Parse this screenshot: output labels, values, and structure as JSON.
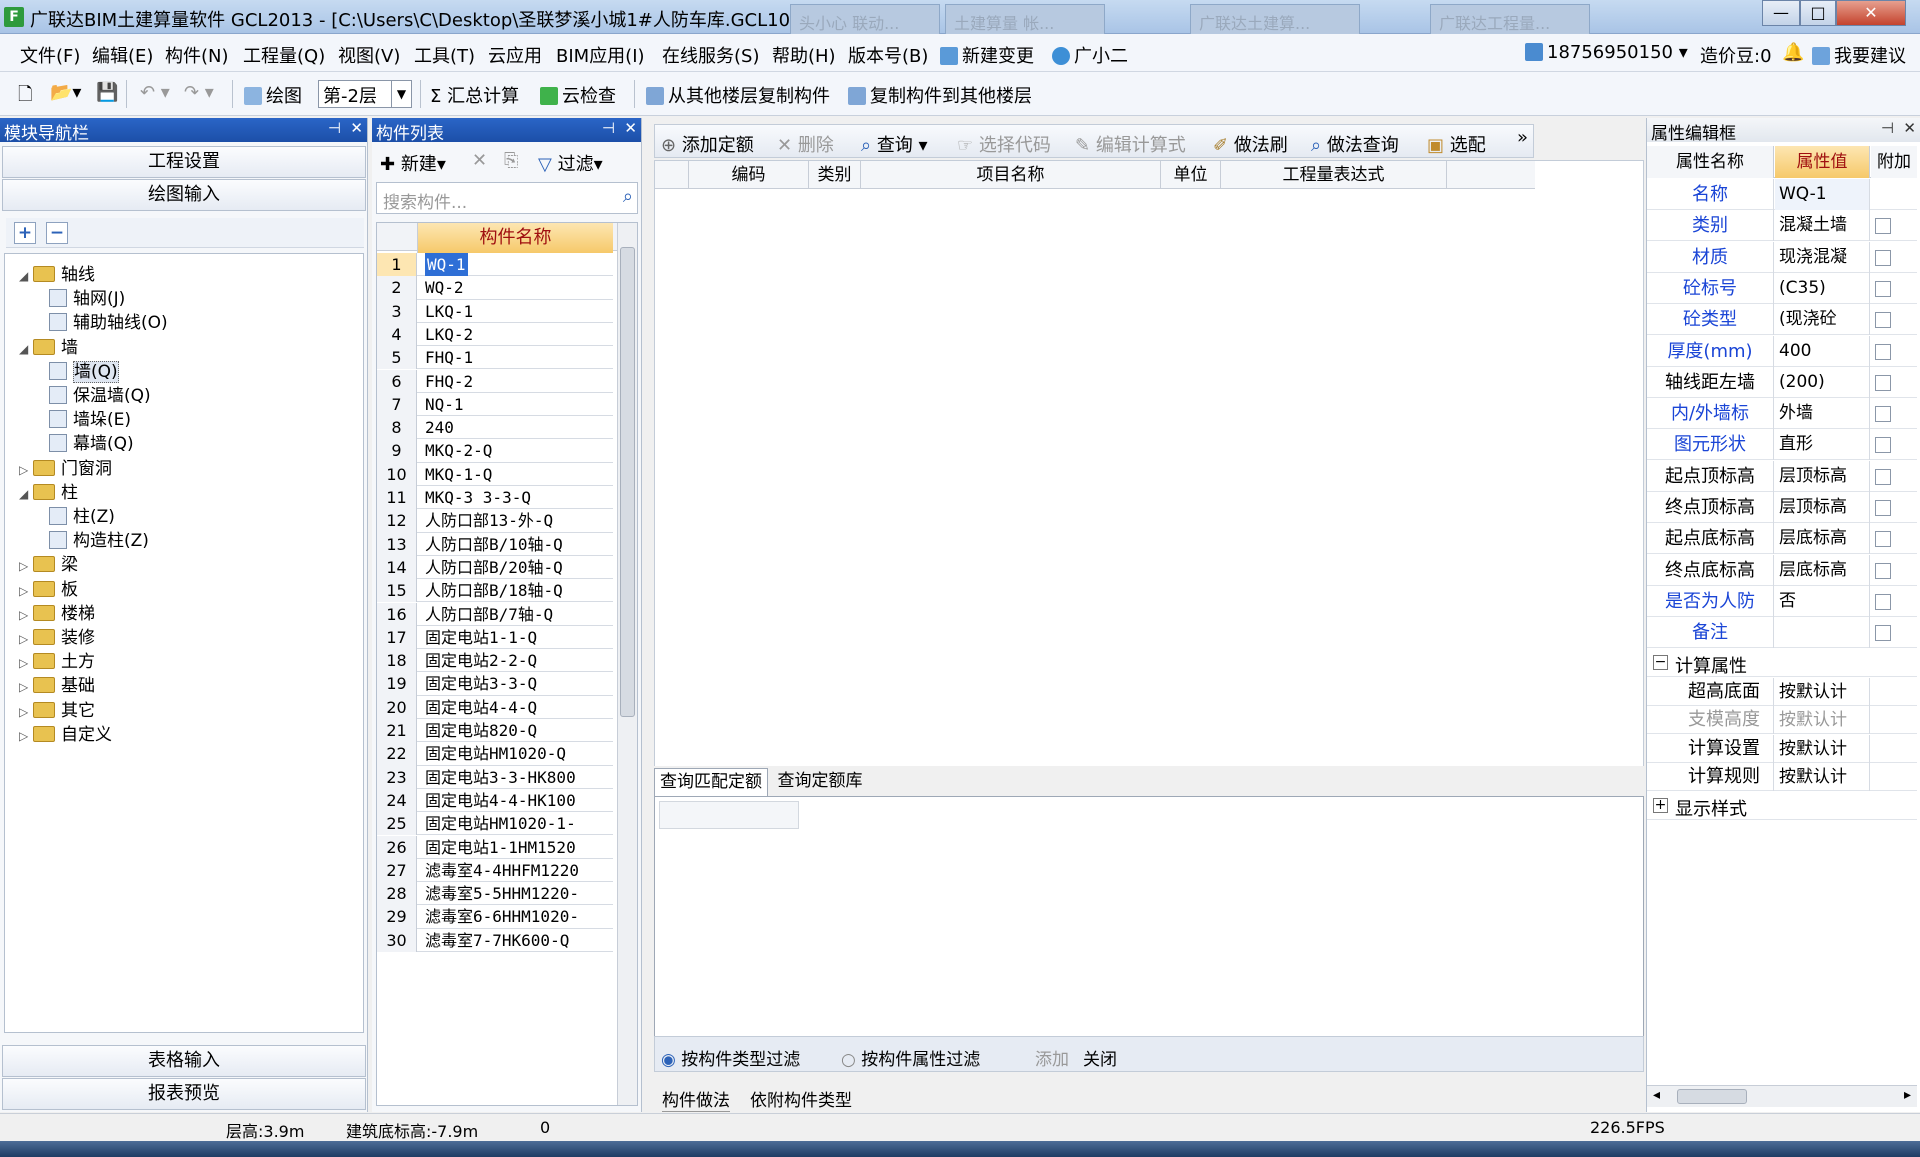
{
  "window": {
    "title": "广联达BIM土建算量软件 GCL2013 - [C:\\Users\\C\\Desktop\\圣联梦溪小城1#人防车库.GCL10]",
    "app_icon": "F",
    "bg_tabs": [
      "头小心 联动...",
      "土建算量  帐...",
      "广联达土建算...",
      "广联达工程量..."
    ],
    "controls": [
      "—",
      "□",
      "✕"
    ]
  },
  "menu": [
    "文件(F)",
    "编辑(E)",
    "构件(N)",
    "工程量(Q)",
    "视图(V)",
    "工具(T)",
    "云应用",
    "BIM应用(I)",
    "在线服务(S)",
    "帮助(H)",
    "版本号(B)",
    "新建变更",
    "广小二"
  ],
  "account": {
    "phone": "18756950150",
    "beans": "造价豆:0",
    "suggest": "我要建议"
  },
  "toolbar": {
    "draw": "绘图",
    "floor": "第-2层",
    "sum": "汇总计算",
    "cloud_check": "云检查",
    "copy_from": "从其他楼层复制构件",
    "copy_to": "复制构件到其他楼层"
  },
  "nav_panel": {
    "title": "模块导航栏",
    "top_buttons": [
      "工程设置",
      "绘图输入"
    ],
    "bottom_buttons": [
      "表格输入",
      "报表预览"
    ],
    "tree": [
      {
        "label": "轴线",
        "level": 0,
        "expanded": true,
        "type": "folder"
      },
      {
        "label": "轴网(J)",
        "level": 1,
        "type": "leaf"
      },
      {
        "label": "辅助轴线(O)",
        "level": 1,
        "type": "leaf"
      },
      {
        "label": "墙",
        "level": 0,
        "expanded": true,
        "type": "folder"
      },
      {
        "label": "墙(Q)",
        "level": 1,
        "type": "leaf",
        "selected": true
      },
      {
        "label": "保温墙(Q)",
        "level": 1,
        "type": "leaf"
      },
      {
        "label": "墙垛(E)",
        "level": 1,
        "type": "leaf"
      },
      {
        "label": "幕墙(Q)",
        "level": 1,
        "type": "leaf"
      },
      {
        "label": "门窗洞",
        "level": 0,
        "expanded": false,
        "type": "folder"
      },
      {
        "label": "柱",
        "level": 0,
        "expanded": true,
        "type": "folder"
      },
      {
        "label": "柱(Z)",
        "level": 1,
        "type": "leaf"
      },
      {
        "label": "构造柱(Z)",
        "level": 1,
        "type": "leaf"
      },
      {
        "label": "梁",
        "level": 0,
        "expanded": false,
        "type": "folder"
      },
      {
        "label": "板",
        "level": 0,
        "expanded": false,
        "type": "folder"
      },
      {
        "label": "楼梯",
        "level": 0,
        "expanded": false,
        "type": "folder"
      },
      {
        "label": "装修",
        "level": 0,
        "expanded": false,
        "type": "folder"
      },
      {
        "label": "土方",
        "level": 0,
        "expanded": false,
        "type": "folder"
      },
      {
        "label": "基础",
        "level": 0,
        "expanded": false,
        "type": "folder"
      },
      {
        "label": "其它",
        "level": 0,
        "expanded": false,
        "type": "folder"
      },
      {
        "label": "自定义",
        "level": 0,
        "expanded": false,
        "type": "folder"
      }
    ]
  },
  "component_panel": {
    "title": "构件列表",
    "new": "新建",
    "filter": "过滤",
    "search_placeholder": "搜索构件...",
    "column": "构件名称",
    "rows": [
      "WQ-1",
      "WQ-2",
      "LKQ-1",
      "LKQ-2",
      "FHQ-1",
      "FHQ-2",
      "NQ-1",
      "240",
      "MKQ-2-Q",
      "MKQ-1-Q",
      "MKQ-3 3-3-Q",
      "人防口部13-外-Q",
      "人防口部B/10轴-Q",
      "人防口部B/20轴-Q",
      "人防口部B/18轴-Q",
      "人防口部B/7轴-Q",
      "固定电站1-1-Q",
      "固定电站2-2-Q",
      "固定电站3-3-Q",
      "固定电站4-4-Q",
      "固定电站820-Q",
      "固定电站HM1020-Q",
      "固定电站3-3-HK800",
      "固定电站4-4-HK100",
      "固定电站HM1020-1-",
      "固定电站1-1HM1520",
      "滤毒室4-4HHFM1220",
      "滤毒室5-5HHM1220-",
      "滤毒室6-6HHM1020-",
      "滤毒室7-7HK600-Q"
    ]
  },
  "quota_panel": {
    "toolbar": [
      "添加定额",
      "删除",
      "查询",
      "选择代码",
      "编辑计算式",
      "做法刷",
      "做法查询",
      "选配"
    ],
    "more": "»",
    "columns": [
      "编码",
      "类别",
      "项目名称",
      "单位",
      "工程量表达式"
    ],
    "lower_tabs": [
      "查询匹配定额",
      "查询定额库"
    ],
    "filter_type": "按构件类型过滤",
    "filter_attr": "按构件属性过滤",
    "add": "添加",
    "close": "关闭",
    "bottom_tabs": [
      "构件做法",
      "依附构件类型"
    ]
  },
  "property_panel": {
    "title": "属性编辑框",
    "headers": [
      "属性名称",
      "属性值",
      "附加"
    ],
    "rows": [
      {
        "name": "名称",
        "value": "WQ-1",
        "blue": true,
        "check": false
      },
      {
        "name": "类别",
        "value": "混凝土墙",
        "blue": true,
        "check": true
      },
      {
        "name": "材质",
        "value": "现浇混凝",
        "blue": true,
        "check": true
      },
      {
        "name": "砼标号",
        "value": "(C35)",
        "blue": true,
        "check": true
      },
      {
        "name": "砼类型",
        "value": "(现浇砼",
        "blue": true,
        "check": true
      },
      {
        "name": "厚度(mm)",
        "value": "400",
        "blue": true,
        "check": true
      },
      {
        "name": "轴线距左墙",
        "value": "(200)",
        "blue": false,
        "check": true
      },
      {
        "name": "内/外墙标",
        "value": "外墙",
        "blue": true,
        "check": true
      },
      {
        "name": "图元形状",
        "value": "直形",
        "blue": true,
        "check": true
      },
      {
        "name": "起点顶标高",
        "value": "层顶标高",
        "blue": false,
        "check": true
      },
      {
        "name": "终点顶标高",
        "value": "层顶标高",
        "blue": false,
        "check": true
      },
      {
        "name": "起点底标高",
        "value": "层底标高",
        "blue": false,
        "check": true
      },
      {
        "name": "终点底标高",
        "value": "层底标高",
        "blue": false,
        "check": true
      },
      {
        "name": "是否为人防",
        "value": "否",
        "blue": true,
        "check": true
      },
      {
        "name": "备注",
        "value": "",
        "blue": true,
        "check": true
      }
    ],
    "calc_group": "计算属性",
    "calc_rows": [
      {
        "name": "超高底面",
        "value": "按默认计",
        "gray": false
      },
      {
        "name": "支模高度",
        "value": "按默认计",
        "gray": true
      },
      {
        "name": "计算设置",
        "value": "按默认计",
        "gray": false
      },
      {
        "name": "计算规则",
        "value": "按默认计",
        "gray": false
      }
    ],
    "display_group": "显示样式"
  },
  "status": {
    "floor_height": "层高:3.9m",
    "base_elev": "建筑底标高:-7.9m",
    "zero": "0",
    "fps": "226.5FPS"
  }
}
